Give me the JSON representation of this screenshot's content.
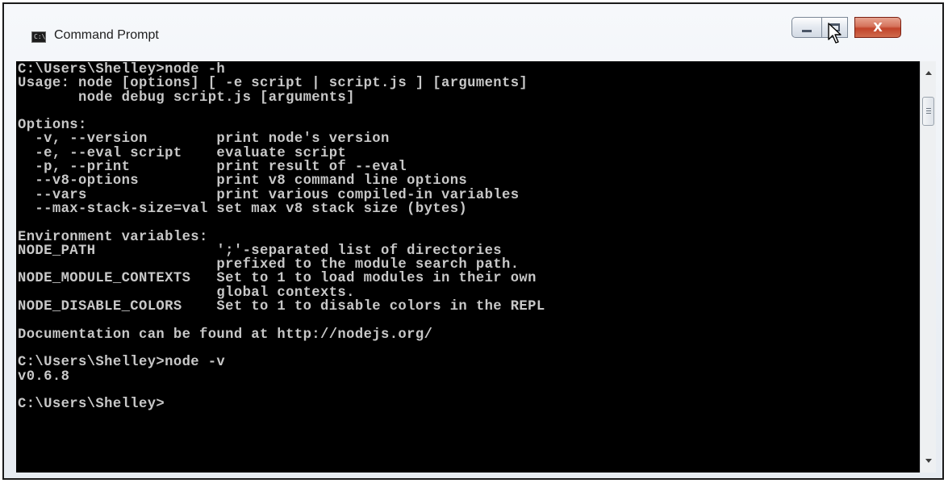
{
  "window": {
    "title": "Command Prompt",
    "icon": "console-icon",
    "close_glyph": "X"
  },
  "console": {
    "lines": [
      "C:\\Users\\Shelley>node -h",
      "Usage: node [options] [ -e script | script.js ] [arguments]",
      "       node debug script.js [arguments]",
      "",
      "Options:",
      "  -v, --version        print node's version",
      "  -e, --eval script    evaluate script",
      "  -p, --print          print result of --eval",
      "  --v8-options         print v8 command line options",
      "  --vars               print various compiled-in variables",
      "  --max-stack-size=val set max v8 stack size (bytes)",
      "",
      "Environment variables:",
      "NODE_PATH              ';'-separated list of directories",
      "                       prefixed to the module search path.",
      "NODE_MODULE_CONTEXTS   Set to 1 to load modules in their own",
      "                       global contexts.",
      "NODE_DISABLE_COLORS    Set to 1 to disable colors in the REPL",
      "",
      "Documentation can be found at http://nodejs.org/",
      "",
      "C:\\Users\\Shelley>node -v",
      "v0.6.8",
      "",
      "C:\\Users\\Shelley>"
    ]
  },
  "colors": {
    "console_background": "#000000",
    "console_text": "#c8c8c8",
    "close_button": "#c1432a"
  },
  "scrollbar": {
    "up_icon": "scroll-up-arrow-icon",
    "down_icon": "scroll-down-arrow-icon"
  }
}
